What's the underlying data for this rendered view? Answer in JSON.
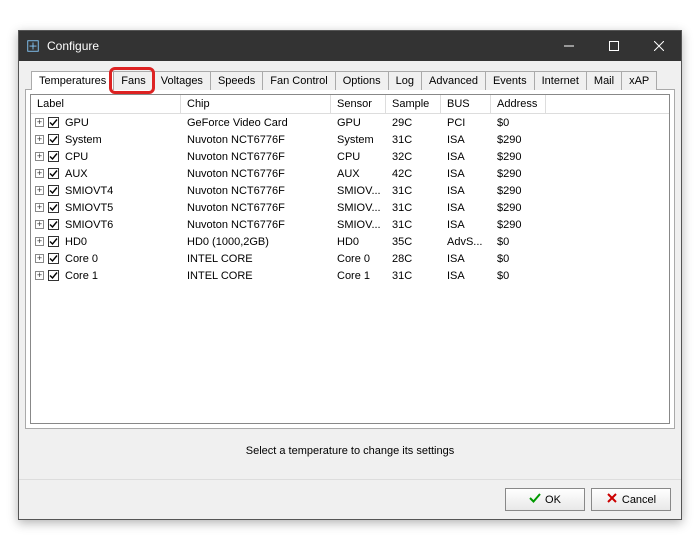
{
  "window": {
    "title": "Configure"
  },
  "tabs": [
    "Temperatures",
    "Fans",
    "Voltages",
    "Speeds",
    "Fan Control",
    "Options",
    "Log",
    "Advanced",
    "Events",
    "Internet",
    "Mail",
    "xAP"
  ],
  "active_tab": 0,
  "highlighted_tab": 1,
  "columns": {
    "label": "Label",
    "chip": "Chip",
    "sensor": "Sensor",
    "sample": "Sample",
    "bus": "BUS",
    "address": "Address"
  },
  "rows": [
    {
      "checked": true,
      "label": "GPU",
      "chip": "GeForce Video Card",
      "sensor": "GPU",
      "sample": "29C",
      "bus": "PCI",
      "address": "$0"
    },
    {
      "checked": true,
      "label": "System",
      "chip": "Nuvoton NCT6776F",
      "sensor": "System",
      "sample": "31C",
      "bus": "ISA",
      "address": "$290"
    },
    {
      "checked": true,
      "label": "CPU",
      "chip": "Nuvoton NCT6776F",
      "sensor": "CPU",
      "sample": "32C",
      "bus": "ISA",
      "address": "$290"
    },
    {
      "checked": true,
      "label": "AUX",
      "chip": "Nuvoton NCT6776F",
      "sensor": "AUX",
      "sample": "42C",
      "bus": "ISA",
      "address": "$290"
    },
    {
      "checked": true,
      "label": "SMIOVT4",
      "chip": "Nuvoton NCT6776F",
      "sensor": "SMIOV...",
      "sample": "31C",
      "bus": "ISA",
      "address": "$290"
    },
    {
      "checked": true,
      "label": "SMIOVT5",
      "chip": "Nuvoton NCT6776F",
      "sensor": "SMIOV...",
      "sample": "31C",
      "bus": "ISA",
      "address": "$290"
    },
    {
      "checked": true,
      "label": "SMIOVT6",
      "chip": "Nuvoton NCT6776F",
      "sensor": "SMIOV...",
      "sample": "31C",
      "bus": "ISA",
      "address": "$290"
    },
    {
      "checked": true,
      "label": "HD0",
      "chip": "HD0 (1000,2GB)",
      "sensor": "HD0",
      "sample": "35C",
      "bus": "AdvS...",
      "address": "$0"
    },
    {
      "checked": true,
      "label": "Core 0",
      "chip": "INTEL CORE",
      "sensor": "Core 0",
      "sample": "28C",
      "bus": "ISA",
      "address": "$0"
    },
    {
      "checked": true,
      "label": "Core 1",
      "chip": "INTEL CORE",
      "sensor": "Core 1",
      "sample": "31C",
      "bus": "ISA",
      "address": "$0"
    }
  ],
  "hint": "Select a temperature to change its settings",
  "buttons": {
    "ok": "OK",
    "cancel": "Cancel"
  }
}
